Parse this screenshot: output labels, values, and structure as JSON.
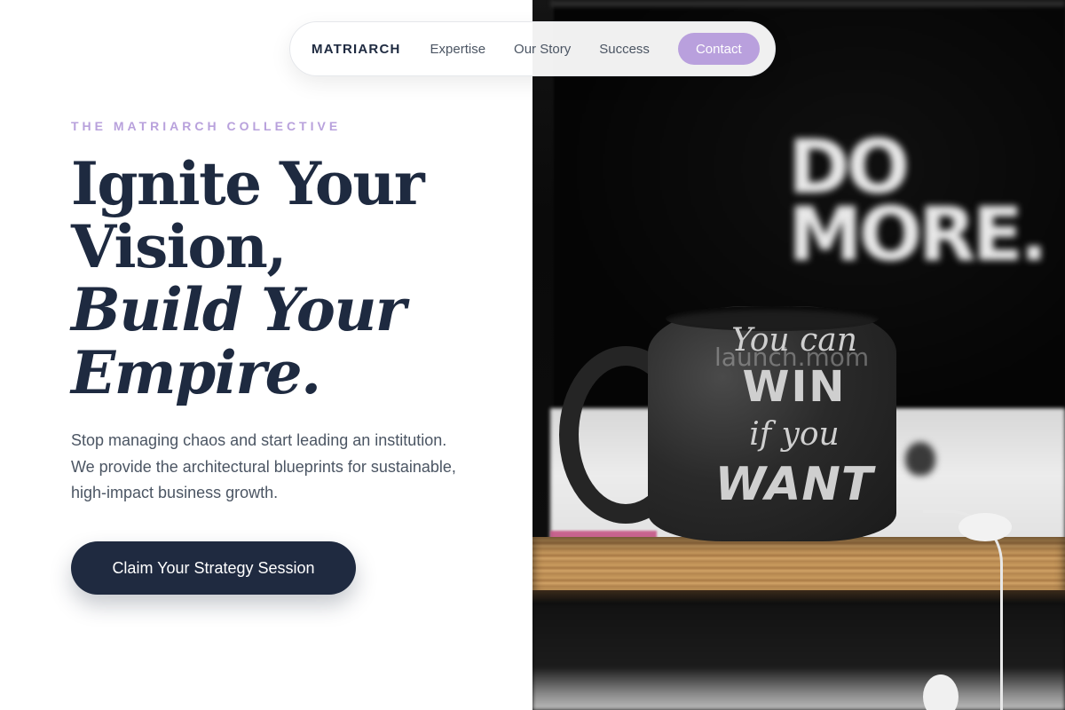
{
  "nav": {
    "brand": "MATRIARCH",
    "links": [
      "Expertise",
      "Our Story",
      "Success"
    ],
    "contact_label": "Contact"
  },
  "hero": {
    "eyebrow": "THE MATRIARCH COLLECTIVE",
    "headline_line1": "Ignite Your",
    "headline_line2": "Vision,",
    "headline_line3": "Build Your",
    "headline_line4": "Empire.",
    "subcopy": "Stop managing chaos and start leading an institution. We provide the architectural blueprints for sustainable, high-impact business growth.",
    "cta_label": "Claim Your Strategy Session"
  },
  "photo": {
    "poster_line1": "DO",
    "poster_line2": "MORE.",
    "mug_line1": "You can",
    "mug_line2": "WIN",
    "mug_line3": "if you",
    "mug_line4": "WANT",
    "watermark": "launch.mom"
  },
  "colors": {
    "navy": "#1f2a40",
    "lavender": "#b9a0dd",
    "eyebrow": "#b8a1dc",
    "body_text": "#4b5563"
  }
}
